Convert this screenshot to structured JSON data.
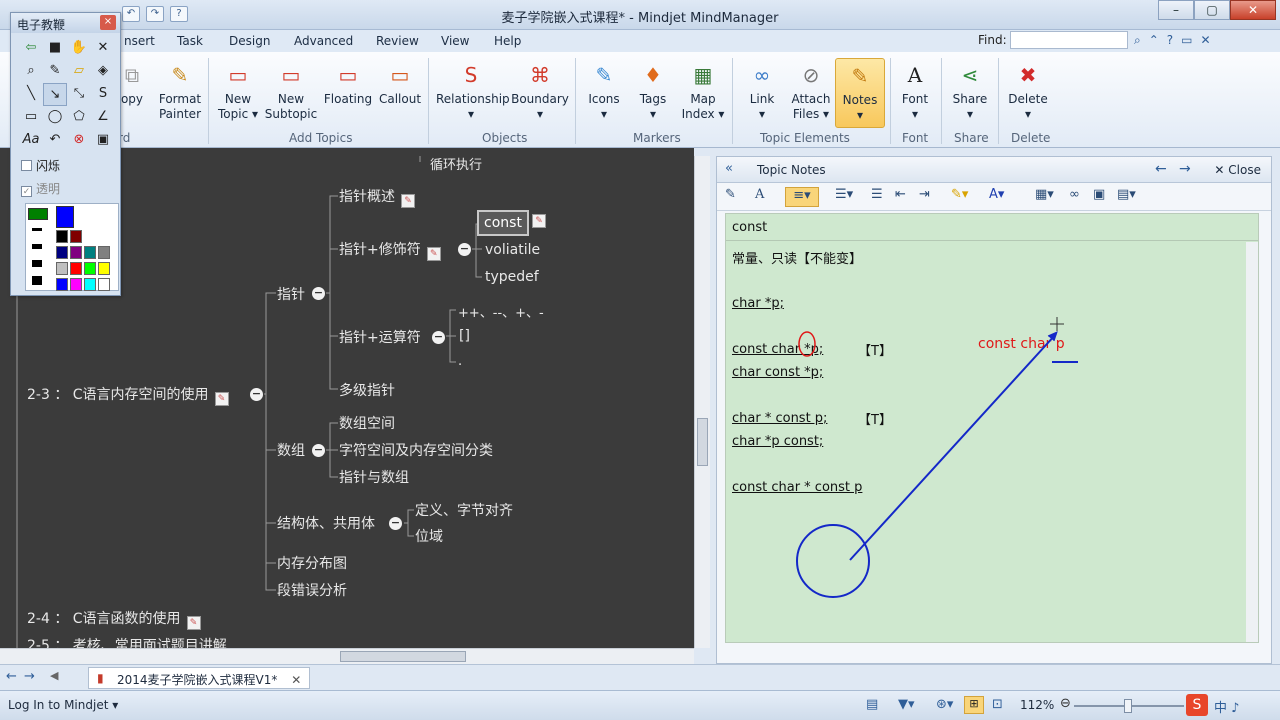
{
  "window": {
    "title": "麦子学院嵌入式课程* - Mindjet MindManager",
    "controls": [
      "–",
      "▢",
      "✕"
    ]
  },
  "quick_access": [
    "↶",
    "↷",
    "?"
  ],
  "menu_tabs": [
    "nsert",
    "Task",
    "Design",
    "Advanced",
    "Review",
    "View",
    "Help"
  ],
  "find": {
    "label": "Find:",
    "value": ""
  },
  "ribbon": {
    "buttons": [
      {
        "label": "opy",
        "icon": "copy-icon",
        "glyph": "⧉"
      },
      {
        "label": "Format\nPainter",
        "icon": "brush-icon",
        "glyph": "🖌"
      },
      {
        "label": "New\nTopic ▾",
        "icon": "new-topic-icon",
        "glyph": "▭"
      },
      {
        "label": "New\nSubtopic",
        "icon": "new-subtopic-icon",
        "glyph": "▭"
      },
      {
        "label": "Floating",
        "icon": "floating-topic-icon",
        "glyph": "▭"
      },
      {
        "label": "Callout",
        "icon": "callout-icon",
        "glyph": "▭"
      },
      {
        "label": "Relationship\n▾",
        "icon": "relationship-icon",
        "glyph": "S"
      },
      {
        "label": "Boundary\n▾",
        "icon": "boundary-icon",
        "glyph": "⌘"
      },
      {
        "label": "Icons\n▾",
        "icon": "icons-icon",
        "glyph": "✎"
      },
      {
        "label": "Tags\n▾",
        "icon": "tags-icon",
        "glyph": "📌"
      },
      {
        "label": "Map\nIndex ▾",
        "icon": "map-index-icon",
        "glyph": "▦"
      },
      {
        "label": "Link\n▾",
        "icon": "link-icon",
        "glyph": "🔗"
      },
      {
        "label": "Attach\nFiles ▾",
        "icon": "paperclip-icon",
        "glyph": "📎"
      },
      {
        "label": "Notes\n▾",
        "icon": "notes-icon",
        "glyph": "📝"
      },
      {
        "label": "Font\n▾",
        "icon": "font-icon",
        "glyph": "A"
      },
      {
        "label": "Share\n▾",
        "icon": "share-icon",
        "glyph": "⋖"
      },
      {
        "label": "Delete\n▾",
        "icon": "delete-icon",
        "glyph": "✖"
      }
    ],
    "groups": [
      "rd",
      "Add Topics",
      "Objects",
      "Markers",
      "Topic Elements",
      "Font",
      "Share",
      "Delete"
    ]
  },
  "map": {
    "top_fragment": "循环执行",
    "nodes": {
      "pointer": "指针",
      "pointer_overview": "指针概述",
      "pointer_modifier": "指针+修饰符",
      "const": "const",
      "volatile": "voliatile",
      "typedef": "typedef",
      "pointer_ops": "指针+运算符",
      "ops1": "++、--、+、-",
      "ops2": "[]",
      "ops3": ".",
      "multi_pointer": "多级指针",
      "section_23": "2-3 ： C语言内存空间的使用",
      "array": "数组",
      "array_space": "数组空间",
      "string_space": "字符空间及内存空间分类",
      "pointer_array": "指针与数组",
      "struct_union": "结构体、共用体",
      "def_align": "定义、字节对齐",
      "bitfield": "位域",
      "mem_map": "内存分布图",
      "seg_fault": "段错误分析",
      "section_24": "2-4 ： C语言函数的使用",
      "section_25": "2-5 ： 考核、常用面试题目讲解"
    }
  },
  "notes": {
    "header": "Topic Notes",
    "close": "Close",
    "title": "const",
    "lines": [
      "常量、只读【不能变】",
      "char *p;",
      "const char *p;",
      "char const *p;",
      "char * const p;",
      "char *p const;",
      "const char * const p"
    ],
    "tag1": "【T】",
    "tag2": "【T】",
    "handwriting": "const char p"
  },
  "doc_tab": "2014麦子学院嵌入式课程V1*",
  "status": {
    "login": "Log In to Mindjet ▾",
    "zoom": "112%"
  },
  "palette": {
    "title": "电子教鞭",
    "close": "×",
    "flash": "闪烁",
    "transparent": "透明",
    "colors": [
      "#008000",
      "#0000ff",
      "#000000",
      "#800000",
      "#000080",
      "#800080",
      "#008080",
      "#808080",
      "#c0c0c0",
      "#ff0000",
      "#00ff00",
      "#ffff00",
      "#0000ff",
      "#ff00ff",
      "#00ffff",
      "#ffffff"
    ]
  }
}
